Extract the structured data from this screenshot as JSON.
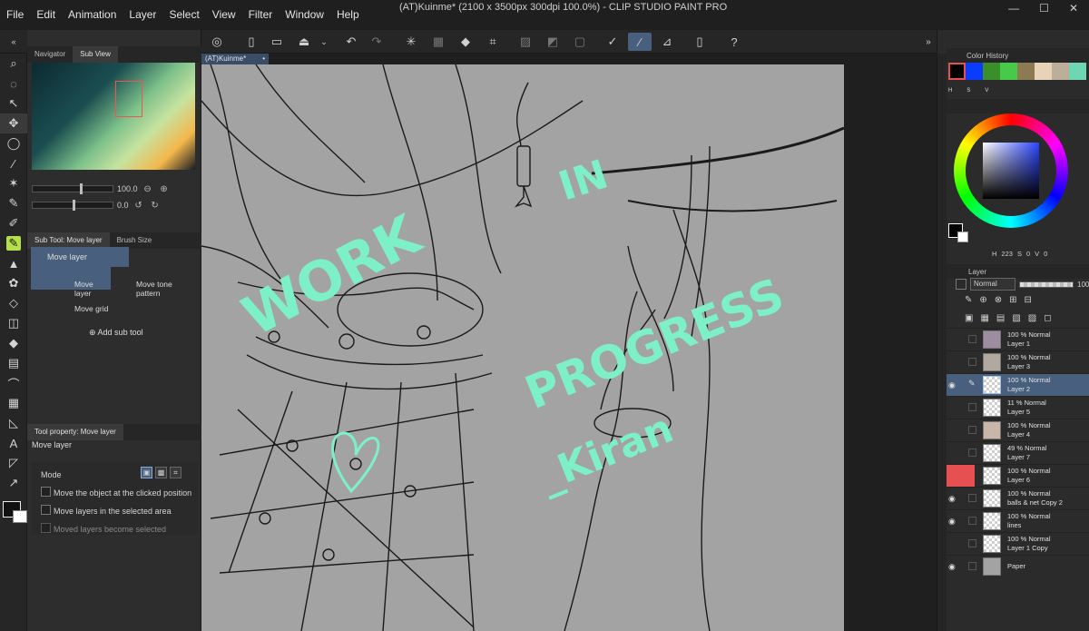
{
  "menu": [
    "File",
    "Edit",
    "Animation",
    "Layer",
    "Select",
    "View",
    "Filter",
    "Window",
    "Help"
  ],
  "window_title": "(AT)Kuinme* (2100 x 3500px 300dpi 100.0%) - CLIP STUDIO PAINT PRO",
  "window_buttons": [
    "—",
    "☐",
    "✕"
  ],
  "command_bar": {
    "icons": [
      "studio-icon",
      "new-icon",
      "open-icon",
      "save-icon",
      "dropdown-icon",
      "undo-icon",
      "redo-icon",
      "loading-icon",
      "clear-icon",
      "fill-icon",
      "transform-icon",
      "deselect-icon",
      "invert-icon",
      "selection-icon",
      "pen-icon",
      "brush-icon",
      "ruler-icon",
      "smartphone-icon",
      "help-icon"
    ]
  },
  "navigator": {
    "tabs": [
      "Navigator",
      "Sub View"
    ],
    "zoom": "100.0",
    "rotation": "0.0"
  },
  "subtool": {
    "tabs": [
      "Sub Tool: Move layer",
      "Brush Size"
    ],
    "group": "Move layer",
    "items": [
      "Move layer",
      "Move tone pattern",
      "Move grid"
    ],
    "add_label": "Add sub tool"
  },
  "tool_property": {
    "tabs": [
      "Tool property: Move layer"
    ],
    "title": "Move layer",
    "mode_label": "Mode",
    "options": [
      {
        "label": "Move the object at the clicked position",
        "checked": false
      },
      {
        "label": "Move layers in the selected area",
        "checked": false
      },
      {
        "label": "Moved layers become selected",
        "checked": false
      }
    ]
  },
  "document": {
    "tab_label": "(AT)Kuinme*",
    "overlay_text": [
      "WORK",
      "IN",
      "PROGRESS",
      "_Kiran"
    ],
    "overlay_color": "#7ef0c8"
  },
  "color_history": {
    "title": "Color History",
    "swatches": [
      "#000000",
      "#0a3cff",
      "#3a8f2a",
      "#47c94a",
      "#8c7b52",
      "#e9d3b8",
      "#bcae98",
      "#6fd6b4"
    ],
    "selected": "#000000",
    "markers": [
      "H",
      "S",
      "V"
    ]
  },
  "color_wheel": {
    "hue": "223",
    "s_label": "S",
    "s_value": "0",
    "v_label": "V",
    "v_value": "0",
    "h_label": "H"
  },
  "layer_panel": {
    "title": "Layer",
    "blend_mode": "Normal",
    "opacity": "100",
    "layers": [
      {
        "pct": "100 % Normal",
        "name": "Layer 1",
        "visible": false,
        "selected": false,
        "red": false
      },
      {
        "pct": "100 % Normal",
        "name": "Layer 3",
        "visible": false,
        "selected": false,
        "red": false
      },
      {
        "pct": "100 % Normal",
        "name": "Layer 2",
        "visible": true,
        "selected": true,
        "red": false
      },
      {
        "pct": "11 % Normal",
        "name": "Layer 5",
        "visible": false,
        "selected": false,
        "red": false
      },
      {
        "pct": "100 % Normal",
        "name": "Layer 4",
        "visible": false,
        "selected": false,
        "red": false
      },
      {
        "pct": "49 % Normal",
        "name": "Layer 7",
        "visible": false,
        "selected": false,
        "red": false
      },
      {
        "pct": "100 % Normal",
        "name": "Layer 6",
        "visible": false,
        "selected": false,
        "red": true
      },
      {
        "pct": "100 % Normal",
        "name": "balls & net Copy 2",
        "visible": true,
        "selected": false,
        "red": false
      },
      {
        "pct": "100 % Normal",
        "name": "lines",
        "visible": true,
        "selected": false,
        "red": false
      },
      {
        "pct": "100 % Normal",
        "name": "Layer 1 Copy",
        "visible": false,
        "selected": false,
        "red": false
      },
      {
        "pct": "",
        "name": "Paper",
        "visible": true,
        "selected": false,
        "red": false
      }
    ]
  }
}
